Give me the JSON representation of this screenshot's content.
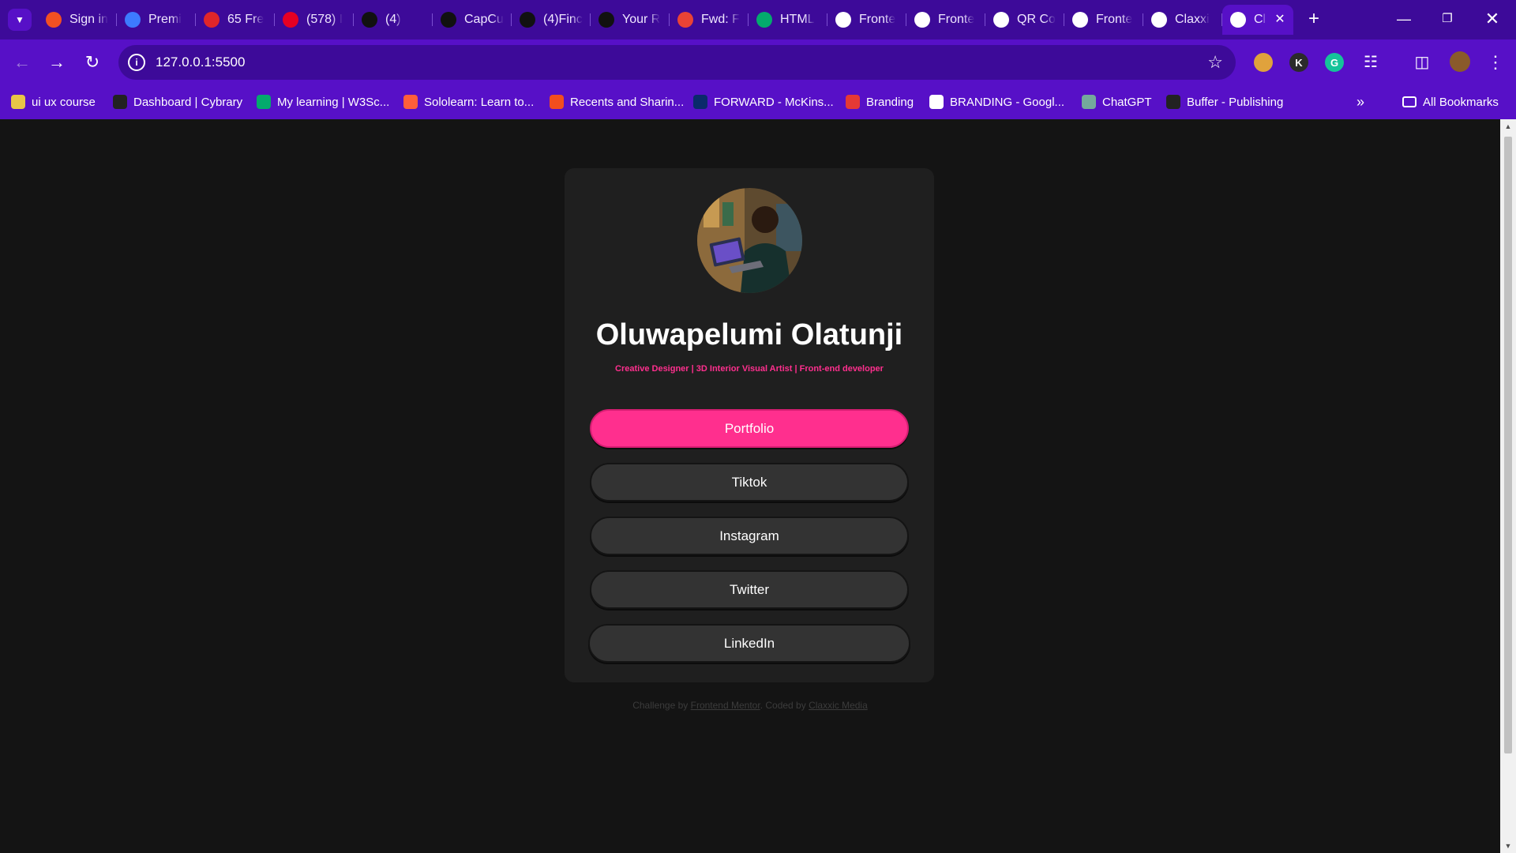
{
  "browser": {
    "tabs": [
      {
        "title": "Sign in",
        "icon": "microsoft-icon",
        "color": "#f25022"
      },
      {
        "title": "Premi",
        "icon": "forms-icon",
        "color": "#3d7bff"
      },
      {
        "title": "65 Fre",
        "icon": "f-icon",
        "color": "#e0262a"
      },
      {
        "title": "(578) I",
        "icon": "pinterest-icon",
        "color": "#e60023"
      },
      {
        "title": "(4)",
        "icon": "capcut-icon",
        "color": "#111111"
      },
      {
        "title": "CapCu",
        "icon": "capcut-icon",
        "color": "#111111"
      },
      {
        "title": "(4)Finc",
        "icon": "tiktok-icon",
        "color": "#111111"
      },
      {
        "title": "Your R",
        "icon": "github-icon",
        "color": "#111111"
      },
      {
        "title": "Fwd: F",
        "icon": "gmail-icon",
        "color": "#ea4335"
      },
      {
        "title": "HTML",
        "icon": "w3schools-icon",
        "color": "#04aa6d"
      },
      {
        "title": "Fronte",
        "icon": "globe-icon",
        "color": "#ffffff"
      },
      {
        "title": "Fronte",
        "icon": "page-icon",
        "color": "#ffffff"
      },
      {
        "title": "QR Co",
        "icon": "globe-icon",
        "color": "#ffffff"
      },
      {
        "title": "Fronte",
        "icon": "globe-icon",
        "color": "#ffffff"
      },
      {
        "title": "Claxxi",
        "icon": "globe-icon",
        "color": "#ffffff"
      },
      {
        "title": "Cl",
        "icon": "globe-icon",
        "color": "#ffffff",
        "active": true
      }
    ],
    "url": "127.0.0.1:5500",
    "extensions": [
      {
        "label": "",
        "icon": "cookie-icon",
        "color": "#e0a23c"
      },
      {
        "label": "K",
        "icon": "k-extension-icon",
        "color": "#2b2b2b"
      },
      {
        "label": "G",
        "icon": "grammarly-icon",
        "color": "#15c39a"
      }
    ],
    "bookmarks": [
      {
        "label": "ui ux course",
        "icon": "bookmark-icon",
        "color": "#e8c547"
      },
      {
        "label": "Dashboard | Cybrary",
        "icon": "cybrary-icon",
        "color": "#222222"
      },
      {
        "label": "My learning | W3Sc...",
        "icon": "w3schools-icon",
        "color": "#04aa6d"
      },
      {
        "label": "Sololearn: Learn to...",
        "icon": "sololearn-icon",
        "color": "#ff5f3a"
      },
      {
        "label": "Recents and Sharin...",
        "icon": "figma-icon",
        "color": "#f24e1e"
      },
      {
        "label": "FORWARD - McKins...",
        "icon": "mckinsey-icon",
        "color": "#0a2a6b"
      },
      {
        "label": "Branding",
        "icon": "branding-icon",
        "color": "#e53935"
      },
      {
        "label": "BRANDING - Googl...",
        "icon": "google-icon",
        "color": "#ffffff"
      },
      {
        "label": "ChatGPT",
        "icon": "chatgpt-icon",
        "color": "#74aa9c"
      },
      {
        "label": "Buffer - Publishing",
        "icon": "buffer-icon",
        "color": "#222222"
      }
    ],
    "all_bookmarks_label": "All Bookmarks"
  },
  "profile": {
    "name": "Oluwapelumi Olatunji",
    "bio": "Creative Designer | 3D Interior Visual Artist | Front-end developer"
  },
  "links": [
    {
      "label": "Portfolio"
    },
    {
      "label": "Tiktok"
    },
    {
      "label": "Instagram"
    },
    {
      "label": "Twitter"
    },
    {
      "label": "LinkedIn"
    }
  ],
  "footer": {
    "challenge_prefix": "Challenge by",
    "challenge_link": "Frontend Mentor",
    "coded_prefix": ". Coded by",
    "coded_link": "Claxxic Media"
  },
  "colors": {
    "accent": "#ff2f8e",
    "chrome": "#5710c7",
    "page_bg": "#141414",
    "card_bg": "#1f1f1f",
    "button_bg": "#333333"
  }
}
